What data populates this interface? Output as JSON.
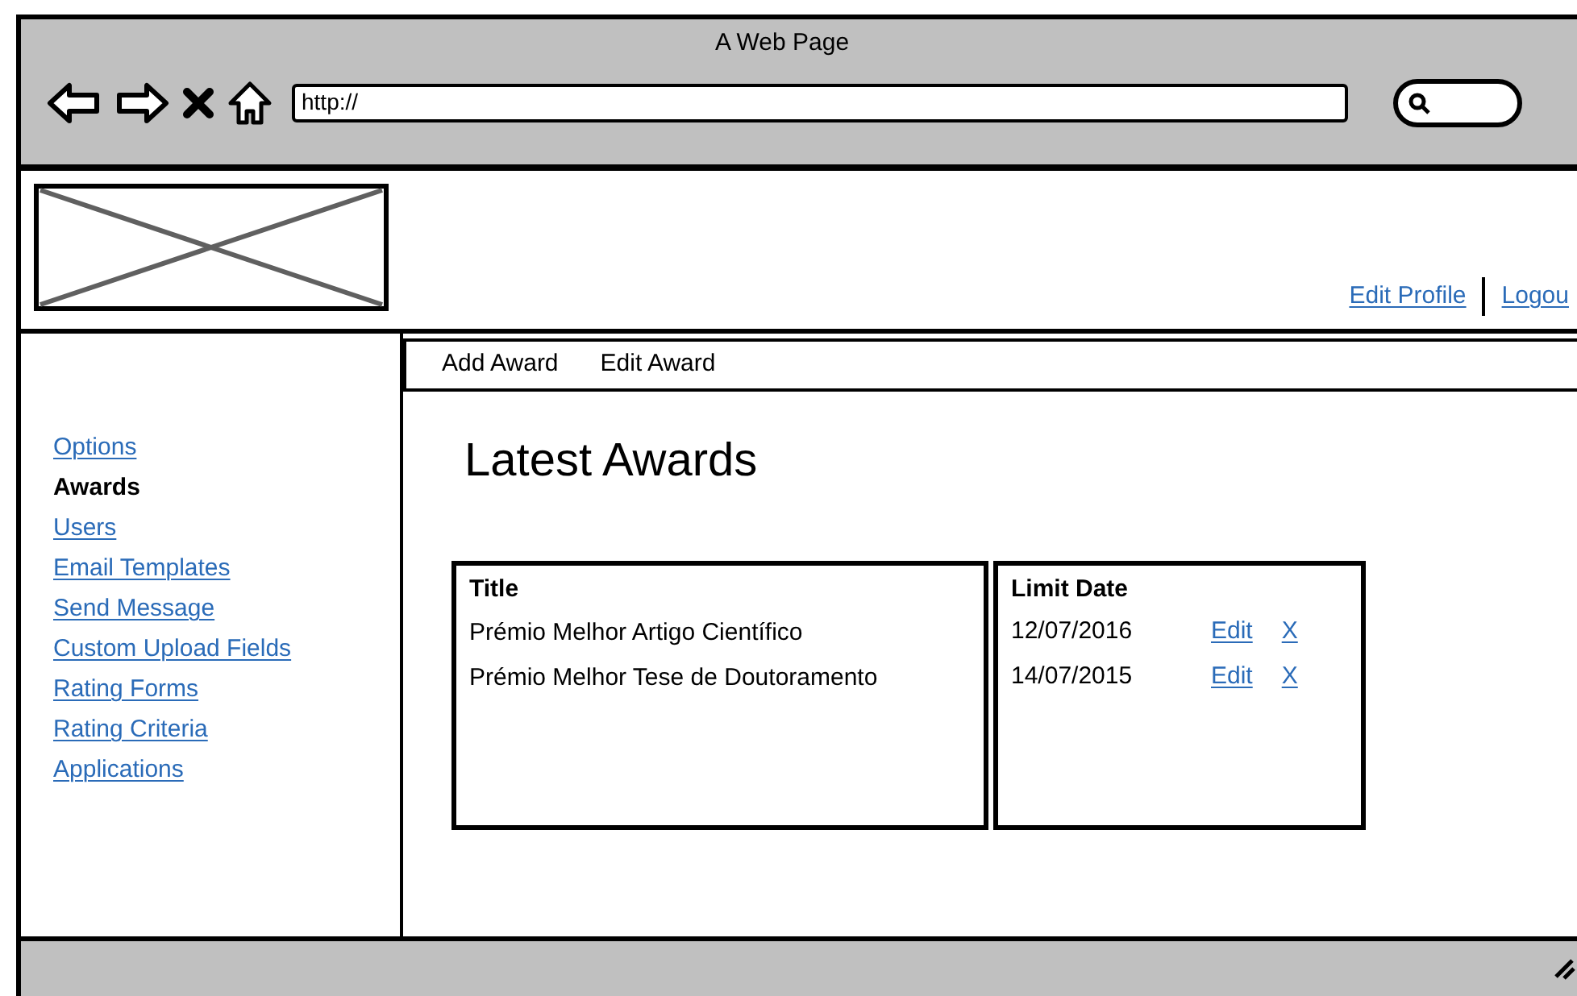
{
  "window": {
    "title": "A Web Page"
  },
  "address_bar": {
    "value": "http://"
  },
  "header": {
    "links": [
      {
        "label": "Edit Profile"
      },
      {
        "label": "Logou"
      }
    ]
  },
  "sidebar": {
    "items": [
      {
        "label": "Options",
        "selected": false
      },
      {
        "label": "Awards",
        "selected": true
      },
      {
        "label": "Users",
        "selected": false
      },
      {
        "label": "Email Templates",
        "selected": false
      },
      {
        "label": "Send Message",
        "selected": false
      },
      {
        "label": "Custom Upload Fields",
        "selected": false
      },
      {
        "label": "Rating Forms",
        "selected": false
      },
      {
        "label": "Rating Criteria",
        "selected": false
      },
      {
        "label": "Applications",
        "selected": false
      }
    ]
  },
  "menu": [
    "Add Award",
    "Edit Award"
  ],
  "heading": "Latest Awards",
  "table": {
    "columns": [
      "Title",
      "Limit Date"
    ],
    "rows": [
      {
        "title": "Prémio Melhor Artigo Científico",
        "limit_date": "12/07/2016",
        "actions": [
          "Edit",
          "X"
        ]
      },
      {
        "title": "Prémio Melhor Tese de Doutoramento",
        "limit_date": "14/07/2015",
        "actions": [
          "Edit",
          "X"
        ]
      }
    ]
  }
}
